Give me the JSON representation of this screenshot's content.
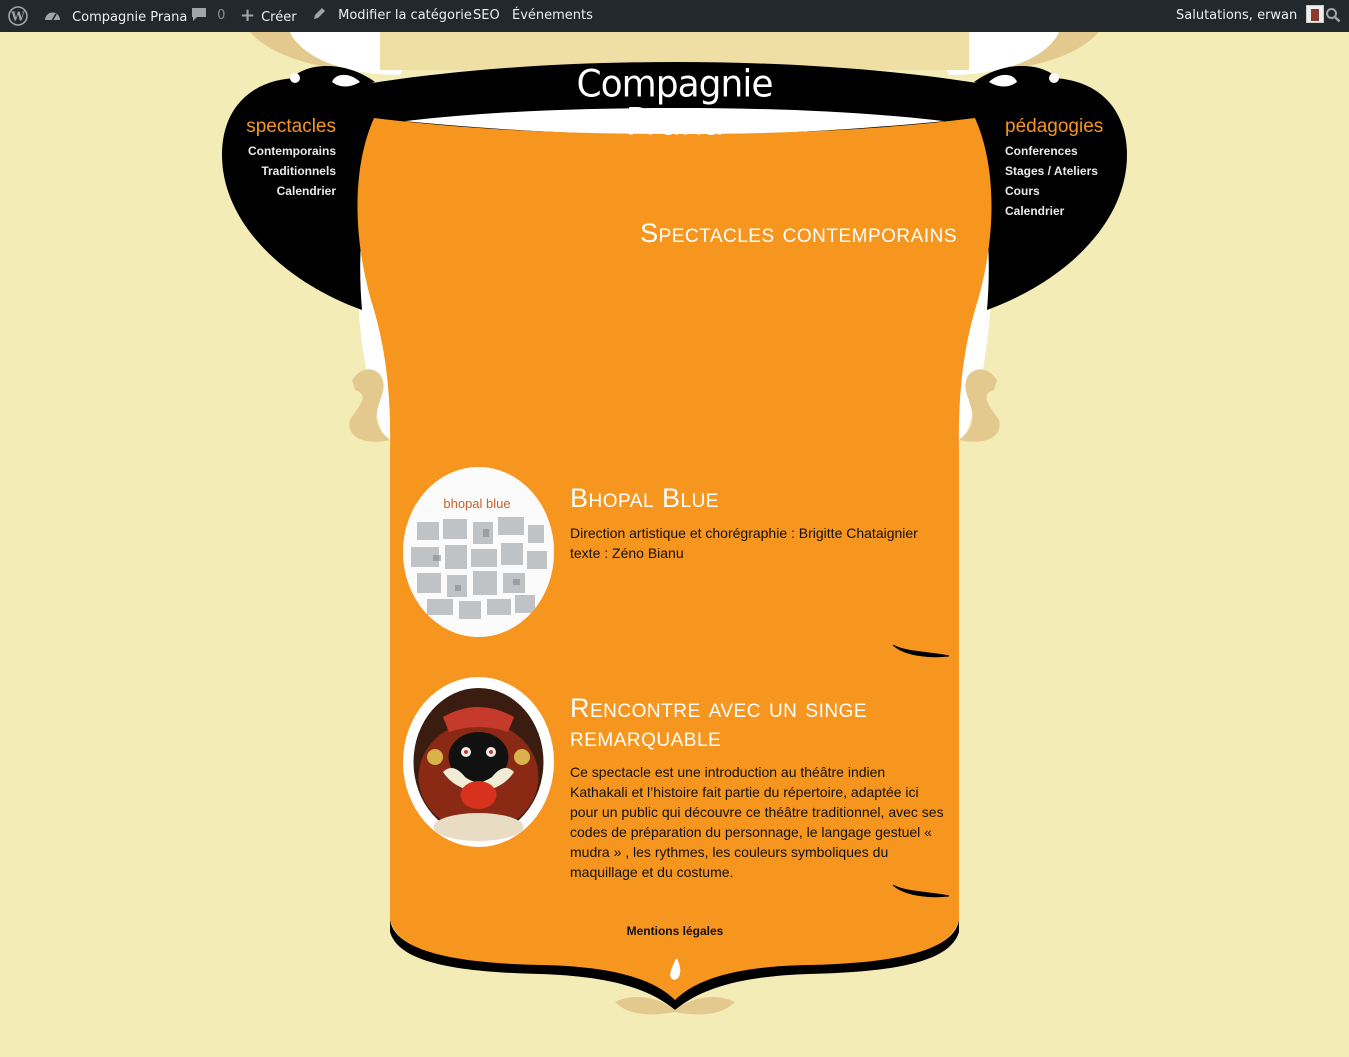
{
  "adminbar": {
    "wp_icon": "wordpress-icon",
    "site_name": "Compagnie Prana",
    "comments_count": "0",
    "create_label": "Créer",
    "edit_category_label": "Modifier la catégorie",
    "seo_label": "SEO",
    "events_label": "Événements",
    "greeting": "Salutations, erwan"
  },
  "site": {
    "logo_text": "Compagnie Prana"
  },
  "nav_left": {
    "title": "spectacles",
    "items": [
      "Contemporains",
      "Traditionnels",
      "Calendrier"
    ]
  },
  "nav_right": {
    "title": "pédagogies",
    "items": [
      "Conferences",
      "Stages / Ateliers",
      "Cours",
      "Calendrier"
    ]
  },
  "page": {
    "title": "Spectacles contemporains"
  },
  "posts": [
    {
      "title": "Bhopal Blue",
      "thumb_caption": "bhopal blue",
      "text_lines": [
        "Direction artistique et chorégraphie : Brigitte Chataignier",
        "texte : Zéno Bianu"
      ]
    },
    {
      "title": "Rencontre avec un singe remarquable",
      "text": "Ce spectacle est une introduction au théâtre indien Kathakali et l’histoire fait partie du répertoire, adaptée ici pour un public qui découvre ce théâtre traditionnel, avec ses codes de préparation du personnage, le langage gestuel « mudra » , les rythmes, les couleurs symboliques du maquillage et du costume."
    }
  ],
  "footer": {
    "legal_label": "Mentions légales"
  },
  "colors": {
    "background": "#f4ecb7",
    "orange": "#f7961f",
    "black": "#000000",
    "beige_ornament": "#e3c98e",
    "adminbar": "#23282d"
  }
}
